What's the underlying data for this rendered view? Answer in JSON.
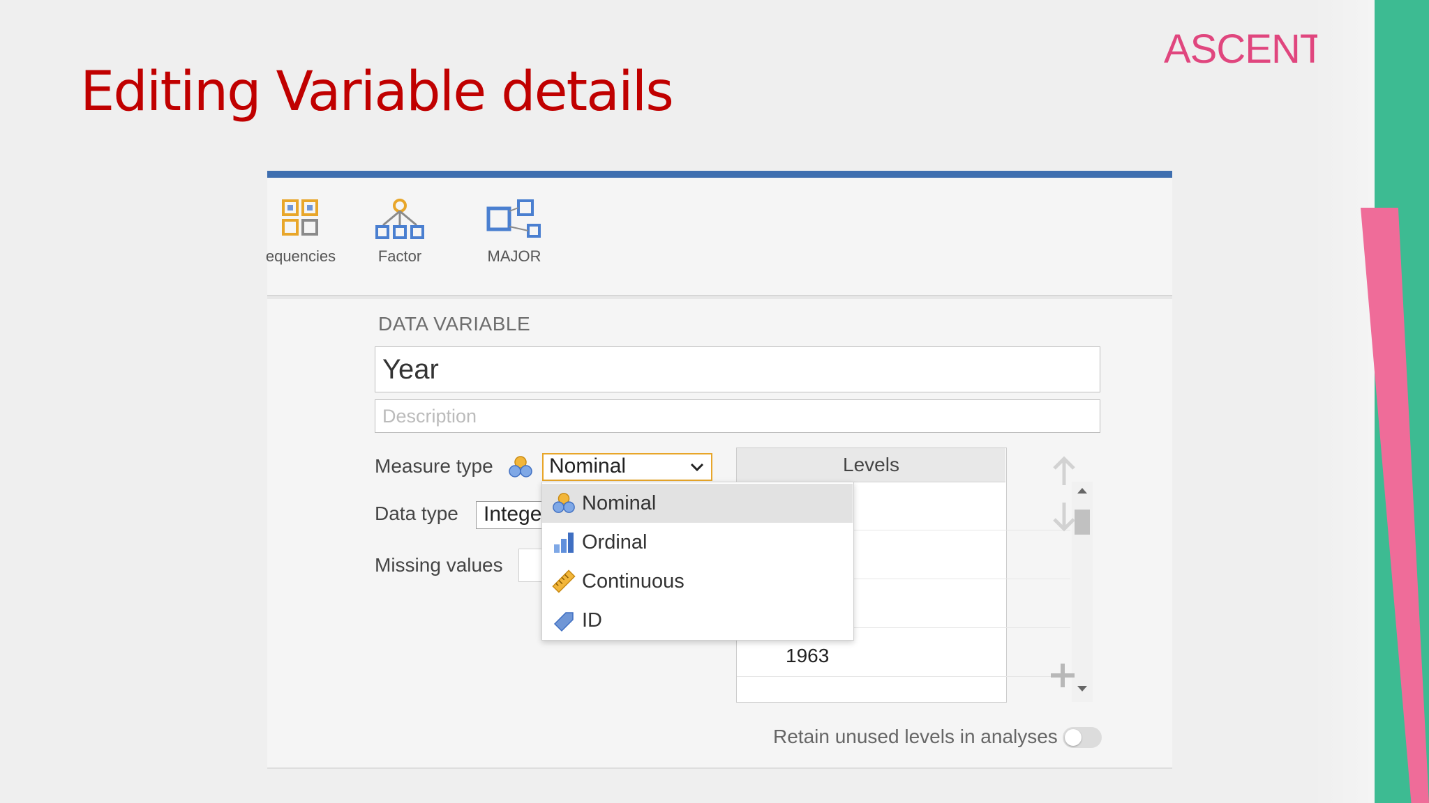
{
  "slide": {
    "title": "Editing Variable details",
    "logo_text": "ASCENT",
    "colors": {
      "title": "#c00000",
      "logo": "#e0467e",
      "deco_green": "#3dbb92",
      "deco_pink": "#ef6c99"
    }
  },
  "toolbar": {
    "items": [
      {
        "label": "equencies",
        "icon": "frequencies-grid-icon"
      },
      {
        "label": "Factor",
        "icon": "factor-tree-icon"
      },
      {
        "label": "MAJOR",
        "icon": "major-squares-icon"
      }
    ],
    "accent_color": "#3e6eaf"
  },
  "editor": {
    "section_label": "DATA VARIABLE",
    "variable_name": "Year",
    "description_placeholder": "Description",
    "measure_type_label": "Measure type",
    "measure_type_value": "Nominal",
    "data_type_label": "Data type",
    "data_type_value": "Intege",
    "missing_values_label": "Missing values",
    "levels": {
      "header": "Levels",
      "visible_value": "1963"
    },
    "retain_label": "Retain unused levels in analyses",
    "retain_enabled": false
  },
  "measure_dropdown": {
    "options": [
      {
        "label": "Nominal",
        "icon": "nominal-circles-icon",
        "selected": true
      },
      {
        "label": "Ordinal",
        "icon": "ordinal-bars-icon",
        "selected": false
      },
      {
        "label": "Continuous",
        "icon": "continuous-ruler-icon",
        "selected": false
      },
      {
        "label": "ID",
        "icon": "id-tag-icon",
        "selected": false
      }
    ]
  }
}
